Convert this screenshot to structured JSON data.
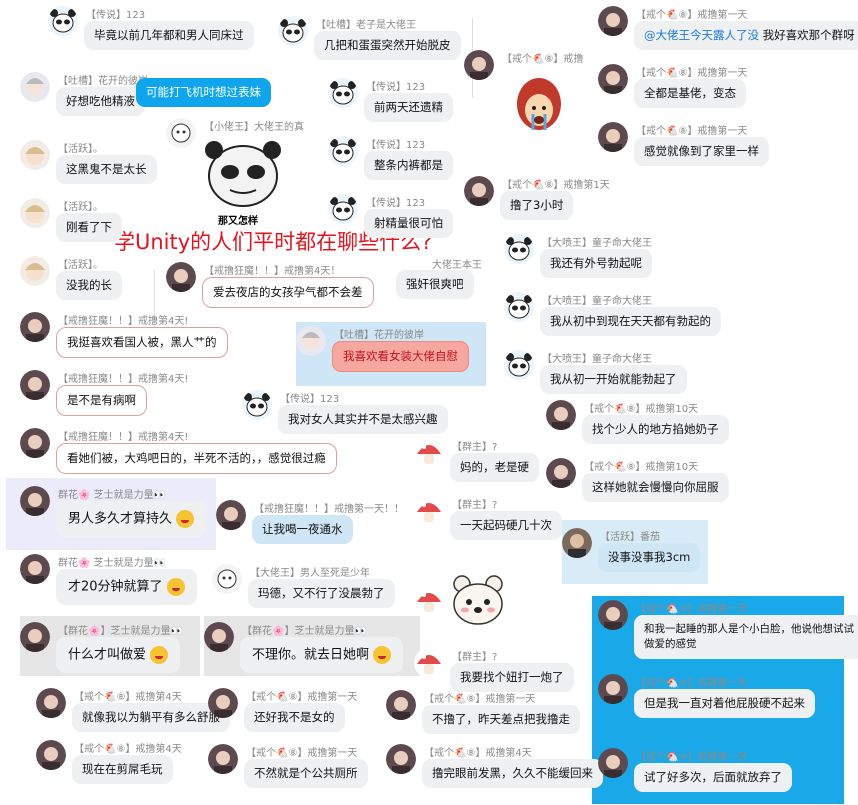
{
  "title": "学Unity的人们平时都在聊些什么?",
  "messages": [
    {
      "id": "m1",
      "meta": "【传说】123",
      "text": "毕竟以前几年都和男人同床过",
      "av": "panda"
    },
    {
      "id": "m2",
      "meta": "【吐槽】老子是大佬王",
      "text": "几把和蛋蛋突然开始脱皮",
      "av": "panda"
    },
    {
      "id": "m3",
      "meta": "【戒个🐔⑧】戒撸第一天",
      "text_pre": "@大佬王今天露人了没",
      "text": " 我好喜欢那个群呀",
      "av": "girl"
    },
    {
      "id": "m4",
      "meta": "【吐槽】花开的彼岸",
      "text": "好想吃他精液",
      "av": "anime"
    },
    {
      "id": "m5",
      "meta": "",
      "text": "可能打飞机时想过表妹",
      "av": "none"
    },
    {
      "id": "m6",
      "meta": "【传说】123",
      "text": "前两天还遗精",
      "av": "panda"
    },
    {
      "id": "m7",
      "meta": "【戒个🐔⑧】戒撸",
      "text": "",
      "av": "girl"
    },
    {
      "id": "m8",
      "meta": "【戒个🐔⑧】戒撸第一天",
      "text": "全都是基佬，变态",
      "av": "girl"
    },
    {
      "id": "m9",
      "meta": "【活跃】。",
      "text": "这黑鬼不是太长",
      "av": "doll"
    },
    {
      "id": "m10",
      "meta": "【小佬王】大佬王的真",
      "text": "",
      "av": "cartoon"
    },
    {
      "id": "m11",
      "meta": "【传说】123",
      "text": "整条内裤都是",
      "av": "panda"
    },
    {
      "id": "m12",
      "meta": "【戒个🐔⑧】戒撸第一天",
      "text": "感觉就像到了家里一样",
      "av": "girl"
    },
    {
      "id": "m13",
      "meta": "【活跃】。",
      "text": "刚看了下",
      "av": "doll"
    },
    {
      "id": "m14",
      "meta": "【传说】123",
      "text": "射精量很可怕",
      "av": "panda"
    },
    {
      "id": "m15",
      "meta": "【戒个🐔⑧】戒撸第1天",
      "text": "撸了3小时",
      "av": "girl"
    },
    {
      "id": "m16",
      "meta": "【大喷王】童子命大佬王",
      "text": "我还有外号勃起呢",
      "av": "panda"
    },
    {
      "id": "m17",
      "meta": "【活跃】。",
      "text": "没我的长",
      "av": "doll"
    },
    {
      "id": "m18",
      "meta": "【戒撸狂魔！！】戒撸第4天！",
      "text": "爱去夜店的女孩孕气都不会差",
      "av": "girl"
    },
    {
      "id": "m19",
      "meta": "",
      "text": "强奸很爽吧",
      "av": "none",
      "extra": "大佬王本王"
    },
    {
      "id": "m20",
      "meta": "【大喷王】童子命大佬王",
      "text": "我从初中到现在天天都有勃起的",
      "av": "panda"
    },
    {
      "id": "m21",
      "meta": "【戒撸狂魔！！】戒撸第4天!",
      "text": "我挺喜欢看国人被，黑人艹的",
      "av": "girl"
    },
    {
      "id": "m22",
      "meta": "【吐槽】花开的彼岸",
      "text": "我喜欢看女装大佬自慰",
      "av": "anime"
    },
    {
      "id": "m23",
      "meta": "【大喷王】童子命大佬王",
      "text": "我从初一开始就能勃起了",
      "av": "panda"
    },
    {
      "id": "m24",
      "meta": "【戒撸狂魔！！】戒撸第4天!",
      "text": "是不是有病啊",
      "av": "girl"
    },
    {
      "id": "m25",
      "meta": "【传说】123",
      "text": "我对女人其实并不是太感兴趣",
      "av": "panda"
    },
    {
      "id": "m26",
      "meta": "【戒个🐔⑧】戒撸第10天",
      "text": "找个少人的地方掐她奶子",
      "av": "girl"
    },
    {
      "id": "m27",
      "meta": "【戒撸狂魔！！】戒撸第4天!",
      "text": "看她们被，大鸡吧日的，半死不活的，，感觉很过瘾",
      "av": "girl"
    },
    {
      "id": "m28",
      "meta": "【群主】?",
      "text": "妈的，老是硬",
      "av": "mush"
    },
    {
      "id": "m29",
      "meta": "【戒个🐔⑧】戒撸第10天",
      "text": "这样她就会慢慢向你屈服",
      "av": "girl"
    },
    {
      "id": "m30",
      "meta": "群花🌸 芝士就是力量👀",
      "text": "男人多久才算持久",
      "av": "girl"
    },
    {
      "id": "m31",
      "meta": "【戒撸狂魔！！】戒撸第一天！！",
      "text": "让我喝一夜通水",
      "av": "girl"
    },
    {
      "id": "m32",
      "meta": "【群主】?",
      "text": "一天起码硬几十次",
      "av": "mush"
    },
    {
      "id": "m33",
      "meta": "【活跃】番茄",
      "text": "没事没事我3cm",
      "av": "man"
    },
    {
      "id": "m34",
      "meta": "群花🌸 芝士就是力量👀",
      "text": "才20分钟就算了",
      "av": "girl"
    },
    {
      "id": "m35",
      "meta": "【大佬王】男人至死是少年",
      "text": "玛德，又不行了没晨勃了",
      "av": "cartoon"
    },
    {
      "id": "m36",
      "meta": "【群主】?",
      "text": "",
      "av": "mush"
    },
    {
      "id": "m37",
      "meta": "【戒个🐔⑧】戒撸第一天",
      "text": "和我一起睡的那人是个小白脸，他说他想试试做爱的感觉",
      "av": "girl"
    },
    {
      "id": "m38",
      "meta": "【群花🌸】芝士就是力量👀",
      "text": "什么才叫做爱",
      "av": "girl"
    },
    {
      "id": "m39",
      "meta": "【群花🌸】芝士就是力量👀",
      "text": "不理你。就去日她啊",
      "av": "girl"
    },
    {
      "id": "m40",
      "meta": "【群主】?",
      "text": "我要找个妞打一炮了",
      "av": "mush"
    },
    {
      "id": "m41",
      "meta": "【戒个🐔⑧】戒撸第一天",
      "text": "但是我一直对着他屁股硬不起来",
      "av": "girl"
    },
    {
      "id": "m42",
      "meta": "【戒个🐔⑧】戒撸第4天",
      "text": "就像我以为躺平有多么舒服",
      "av": "girl"
    },
    {
      "id": "m43",
      "meta": "【戒个🐔⑧】戒撸第一天",
      "text": "还好我不是女的",
      "av": "girl"
    },
    {
      "id": "m44",
      "meta": "【戒个🐔⑧】戒撸第一天",
      "text": "不撸了，昨天差点把我撸走",
      "av": "girl"
    },
    {
      "id": "m45",
      "meta": "【戒个🐔⑧】戒撸第4天",
      "text": "现在在剪屌毛玩",
      "av": "girl"
    },
    {
      "id": "m46",
      "meta": "【戒个🐔⑧】戒撸第一天",
      "text": "不然就是个公共厕所",
      "av": "girl"
    },
    {
      "id": "m47",
      "meta": "【戒个🐔⑧】戒撸第4天",
      "text": "撸完眼前发黑，久久不能缓回来",
      "av": "girl"
    },
    {
      "id": "m48",
      "meta": "【戒个🐔⑧】戒撸第一天",
      "text": "试了好多次，后面就放弃了",
      "av": "girl"
    }
  ],
  "sticker_caption": "那又怎样"
}
